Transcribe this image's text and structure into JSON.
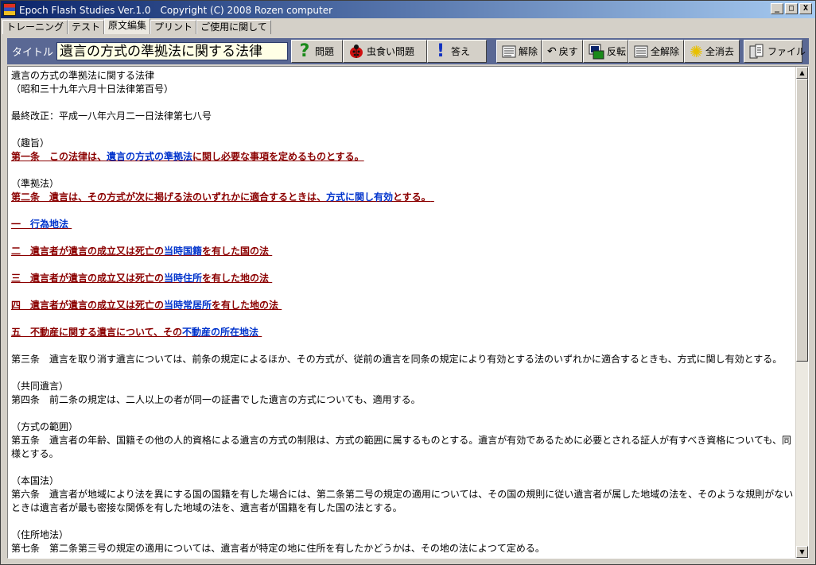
{
  "window": {
    "title": "Epoch Flash Studies Ver.1.0　Copyright (C) 2008 Rozen computer",
    "min": "_",
    "max": "□",
    "close": "X"
  },
  "tabs": [
    "トレーニング",
    "テスト",
    "原文編集",
    "プリント",
    "ご使用に関して"
  ],
  "toolbar": {
    "title_label": "タイトル",
    "title_value": "遺言の方式の準拠法に関する法律",
    "question": "問題",
    "bug_question": "虫食い問題",
    "answer": "答え",
    "release": "解除",
    "undo": "戻す",
    "invert": "反転",
    "release_all": "全解除",
    "clear_all": "全消去",
    "file": "ファイル"
  },
  "doc": {
    "l1": "遺言の方式の準拠法に関する法律",
    "l2": "（昭和三十九年六月十日法律第百号）",
    "l3": "最終改正：平成一八年六月二一日法律第七八号",
    "h1": "（趣旨）",
    "a1a": "第一条　この法律は、",
    "a1b": "遺言の方式の準拠法",
    "a1c": "に関し必要な事項を定めるものとする。",
    "h2": "（準拠法）",
    "a2a": "第二条　遺言は、その方式が次に掲げる法のいずれかに適合するときは、",
    "a2b": "方式に関し有効",
    "a2c": "とする。",
    "i1a": "一　",
    "i1b": "行為地法",
    "i2a": "二　遺言者が遺言の成立又は死亡の",
    "i2b": "当時国籍",
    "i2c": "を有した国の法",
    "i3a": "三　遺言者が遺言の成立又は死亡の",
    "i3b": "当時住所",
    "i3c": "を有した地の法",
    "i4a": "四　遺言者が遺言の成立又は死亡の",
    "i4b": "当時常居所",
    "i4c": "を有した地の法",
    "i5a": "五　不動産に関する遺言について、その",
    "i5b": "不動産の所在地法",
    "a3": "第三条　遺言を取り消す遺言については、前条の規定によるほか、その方式が、従前の遺言を同条の規定により有効とする法のいずれかに適合するときも、方式に関し有効とする。",
    "h4": "（共同遺言）",
    "a4": "第四条　前二条の規定は、二人以上の者が同一の証書でした遺言の方式についても、適用する。",
    "h5": "（方式の範囲）",
    "a5": "第五条　遺言者の年齢、国籍その他の人的資格による遺言の方式の制限は、方式の範囲に属するものとする。遺言が有効であるために必要とされる証人が有すべき資格についても、同様とする。",
    "h6": "（本国法）",
    "a6": "第六条　遺言者が地域により法を異にする国の国籍を有した場合には、第二条第二号の規定の適用については、その国の規則に従い遺言者が属した地域の法を、そのような規則がないときは遺言者が最も密接な関係を有した地域の法を、遺言者が国籍を有した国の法とする。",
    "h7": "（住所地法）",
    "a7": "第七条　第二条第三号の規定の適用については、遺言者が特定の地に住所を有したかどうかは、その地の法によつて定める。"
  },
  "colors": {
    "toolbar_bg": "#5a6894",
    "title_bg": "#ffffe6",
    "marked_red": "#8b0000",
    "marked_blue": "#0033cc"
  },
  "icons": [
    "app-icon",
    "question-mark-icon",
    "ladybug-icon",
    "exclamation-icon",
    "release-icon",
    "undo-arrow-icon",
    "invert-icon",
    "release-all-icon",
    "clear-all-icon",
    "file-icon"
  ]
}
